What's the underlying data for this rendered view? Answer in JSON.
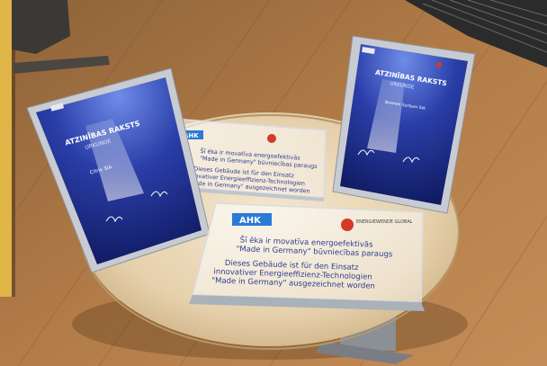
{
  "scene": {
    "description_colors": {
      "floor": "#b07a45",
      "table": "#ead7b8",
      "certificate_blue": "#1d2f8a",
      "frame_silver": "#c9cdd3",
      "wall_yellow": "#e0b548"
    }
  },
  "left_certificate": {
    "title": "ATZINĪBAS RAKSTS",
    "subtitle": "URKUNDE",
    "recipient": "Citrix SIA"
  },
  "right_certificate": {
    "title": "ATZINĪBAS RAKSTS",
    "subtitle": "URKUNDE",
    "recipient": "Bremen Surbam SIA"
  },
  "back_plaque": {
    "logo_text": "AHK",
    "line1": "Šī ēka ir movatīva energoefektivās",
    "line2": "\"Made in Germany\" būvniecības paraugs",
    "line3": "Dieses Gebäude ist für den Einsatz",
    "line4": "innovativer Energieeffizienz-Technologien",
    "line5": "\"Made in Germany\" ausgezeichnet worden"
  },
  "front_plaque": {
    "logo_text": "AHK",
    "partner_logo": "ENERGIEWENDE GLOBAL",
    "line1": "Šī ēka ir movatīva energoefektivās",
    "line2": "\"Made in Germany\" būvniecības paraugs",
    "line3": "Dieses Gebäude ist für den Einsatz",
    "line4": "innovativer Energieeffizienz-Technologien",
    "line5": "\"Made in Germany\" ausgezeichnet worden"
  }
}
